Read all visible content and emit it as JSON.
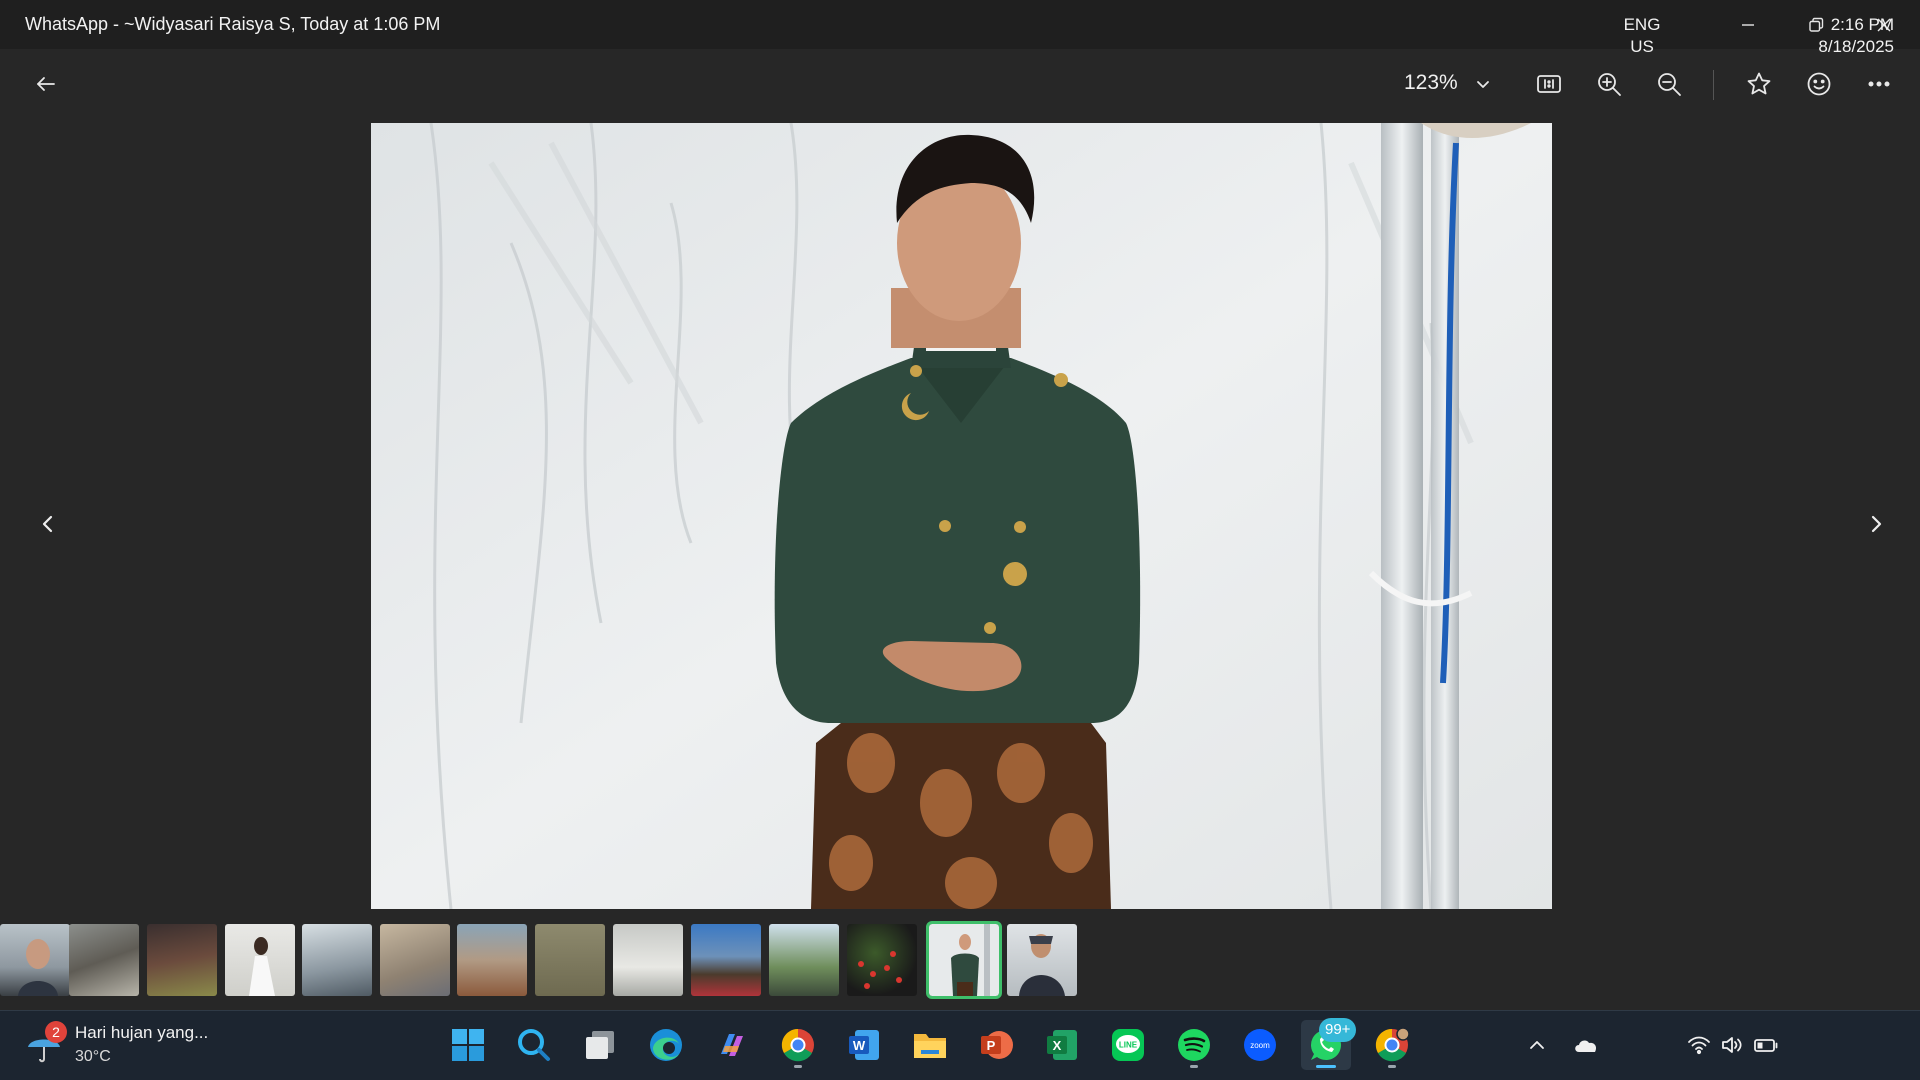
{
  "window": {
    "title": "WhatsApp - ~Widyasari Raisya S, Today at 1:06 PM"
  },
  "viewer": {
    "zoom_level": "123%",
    "toolbar_icons": [
      "back-arrow-icon",
      "chevron-down-icon",
      "actual-size-icon",
      "zoom-in-icon",
      "zoom-out-icon",
      "star-icon",
      "emoji-icon",
      "more-icon"
    ],
    "photo_subject": "man-in-green-jacket-and-batik",
    "thumbnails_count": 14,
    "active_thumbnail_index": 12
  },
  "taskbar": {
    "weather": {
      "badge": "2",
      "text": "Hari hujan yang...",
      "temp": "30°C"
    },
    "apps": [
      "windows-start-icon",
      "search-icon",
      "task-view-icon",
      "edge-icon",
      "copilot-icon",
      "chrome-icon",
      "word-icon",
      "file-explorer-icon",
      "powerpoint-icon",
      "excel-icon",
      "line-icon",
      "spotify-icon",
      "zoom-icon",
      "whatsapp-icon",
      "chrome-profile-icon"
    ],
    "whatsapp_badge": "99+",
    "zoom_app_label": "zoom",
    "word_letter": "W",
    "powerpoint_letter": "P",
    "excel_letter": "X",
    "line_label": "LINE",
    "language": {
      "line1": "ENG",
      "line2": "US"
    },
    "clock": {
      "time": "2:16 PM",
      "date": "8/18/2025"
    }
  },
  "colors": {
    "background": "#272727",
    "titlebar": "#1f1f1f",
    "taskbar": "#1c2530",
    "active_thumb_border": "#3fbf6a",
    "jacket": "#2f4a3e"
  }
}
